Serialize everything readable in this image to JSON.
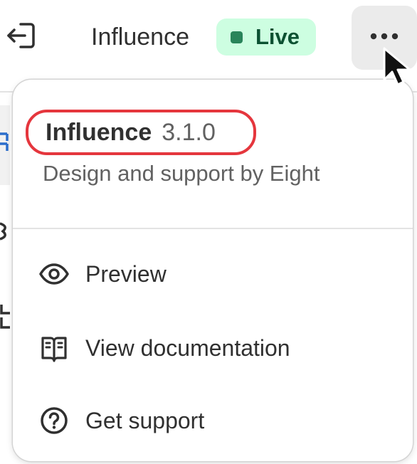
{
  "header": {
    "exit_icon": "exit-icon",
    "theme_name": "Influence",
    "status_badge": "Live",
    "status_color": "#29845a",
    "more_icon": "more-horizontal-icon"
  },
  "popover": {
    "title": "Influence",
    "version": "3.1.0",
    "credit": "Design and support by Eight",
    "highlight_color": "#e5363d",
    "items": [
      {
        "icon": "eye-icon",
        "label": "Preview"
      },
      {
        "icon": "book-icon",
        "label": "View documentation"
      },
      {
        "icon": "question-circle-icon",
        "label": "Get support"
      }
    ]
  }
}
